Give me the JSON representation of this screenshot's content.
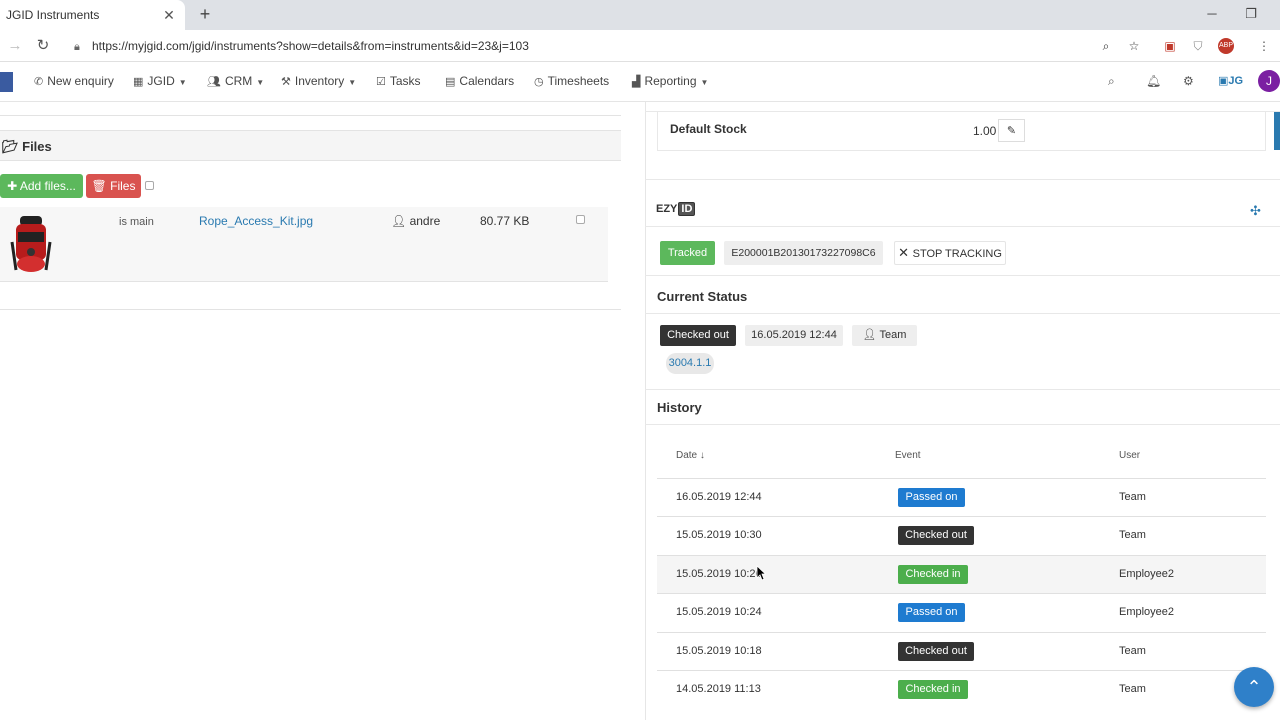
{
  "browser": {
    "tab_title": "JGID Instruments",
    "url": "https://myjgid.com/jgid/instruments?show=details&from=instruments&id=23&j=103"
  },
  "nav": {
    "items": [
      "New enquiry",
      "JGID",
      "CRM",
      "Inventory",
      "Tasks",
      "Calendars",
      "Timesheets",
      "Reporting"
    ],
    "avatar_letter": "J",
    "jg_label": "JG"
  },
  "files": {
    "title": "Files",
    "add_label": "Add files...",
    "delete_label": "Files",
    "row": {
      "main_label": "is main",
      "name": "Rope_Access_Kit.jpg",
      "user": "andre",
      "size": "80.77 KB"
    }
  },
  "stock": {
    "label": "Default Stock",
    "value": "1.00"
  },
  "ezy": {
    "prefix": "EZY",
    "box": "ID",
    "tracked_label": "Tracked",
    "tag_code": "E200001B20130173227098C6",
    "stop_label": "STOP TRACKING"
  },
  "current_status": {
    "title": "Current Status",
    "status": "Checked out",
    "datetime": "16.05.2019 12:44",
    "user": "Team",
    "version": "3004.1.1"
  },
  "history": {
    "title": "History",
    "columns": [
      "Date",
      "Event",
      "User"
    ],
    "rows": [
      {
        "date": "16.05.2019 12:44",
        "event": "Passed on",
        "user": "Team"
      },
      {
        "date": "15.05.2019 10:30",
        "event": "Checked out",
        "user": "Team"
      },
      {
        "date": "15.05.2019 10:26",
        "event": "Checked in",
        "user": "Employee2"
      },
      {
        "date": "15.05.2019 10:24",
        "event": "Passed on",
        "user": "Employee2"
      },
      {
        "date": "15.05.2019 10:18",
        "event": "Checked out",
        "user": "Team"
      },
      {
        "date": "14.05.2019 11:13",
        "event": "Checked in",
        "user": "Team"
      }
    ]
  },
  "colors": {
    "green": "#5cb85c",
    "red": "#d9534f",
    "blue": "#1e7bd0",
    "dark": "#333333",
    "link": "#2a7ab0"
  }
}
